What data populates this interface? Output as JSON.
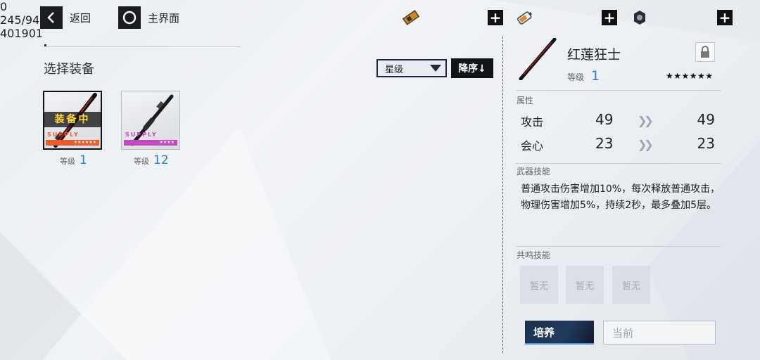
{
  "topbar": {
    "back_label": "返回",
    "home_label": "主界面",
    "resources": [
      {
        "icon": "ticket-icon",
        "value": "0"
      },
      {
        "icon": "battery-icon",
        "value": "245/94"
      },
      {
        "icon": "gear-coin-icon",
        "value": "401901"
      }
    ]
  },
  "list": {
    "title": "选择装备",
    "sort_select": "星级",
    "sort_order": "降序↓",
    "items": [
      {
        "badge": "装备中",
        "supply": "SUPPLY",
        "stars": "★★★★★★",
        "level_label": "等级",
        "level": "1",
        "accent": "#f05a28"
      },
      {
        "badge": "",
        "supply": "SUPPLY",
        "stars": "★★★★",
        "level_label": "等级",
        "level": "12",
        "accent": "#c447c4"
      }
    ]
  },
  "detail": {
    "name": "红莲狂士",
    "level_label": "等级",
    "level": "1",
    "stars": "★★★★★★",
    "attr_header": "属性",
    "stats": [
      {
        "name": "攻击",
        "current": "49",
        "next": "49"
      },
      {
        "name": "会心",
        "current": "23",
        "next": "23"
      }
    ],
    "skill_header": "武器技能",
    "skill_desc": "普通攻击伤害增加10%，每次释放普通攻击，物理伤害增加5%，持续2秒，最多叠加5层。",
    "resonance_header": "共鸣技能",
    "resonance_slots": [
      "暂无",
      "暂无",
      "暂无"
    ],
    "train_label": "培养",
    "current_label": "当前"
  },
  "colors": {
    "accent_blue": "#2a7fd4",
    "equipped_yellow": "#ffd838",
    "dark": "#111418"
  }
}
